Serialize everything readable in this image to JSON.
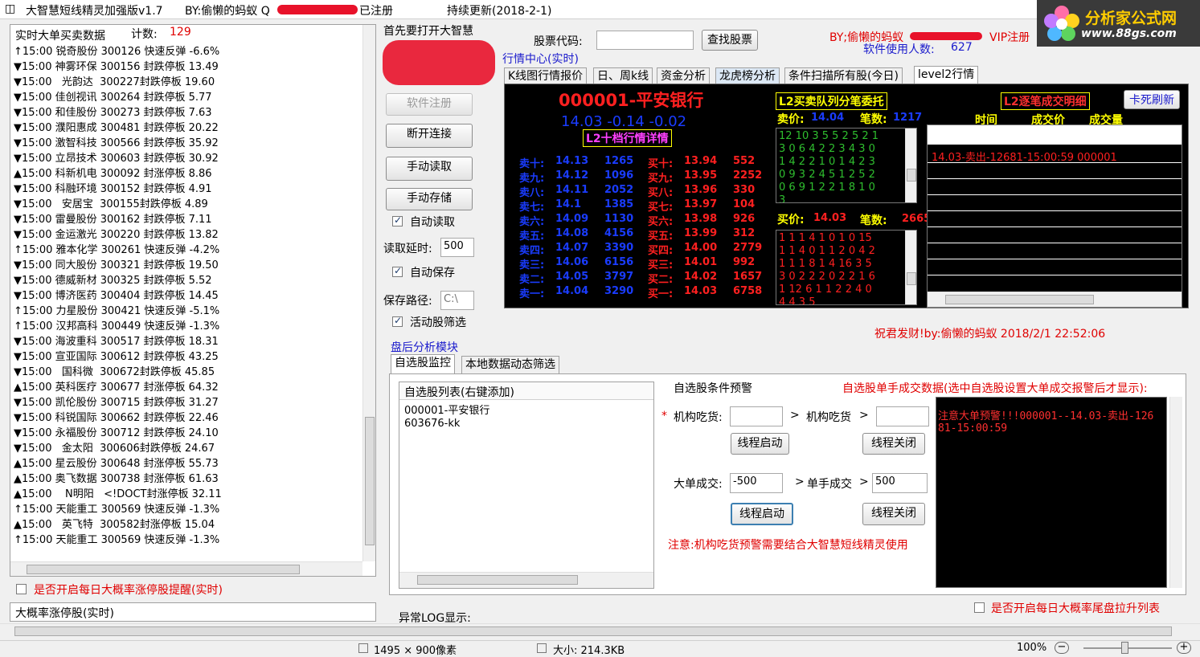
{
  "window": {
    "title": "大智慧短线精灵加强版v1.7",
    "author": "BY:偷懒的蚂蚁 Q",
    "registered": "已注册",
    "update": "持续更新(2018-2-1)"
  },
  "logo": {
    "main": "分析家公式网",
    "url": "www.88gs.com"
  },
  "realtime": {
    "title": "实时大单买卖数据",
    "count_label": "计数:",
    "count": "129",
    "rows": [
      "↑15:00 锐奇股份 300126 快速反弹 -6.6%",
      "▼15:00 神雾环保 300156 封跌停板 13.49",
      "▼15:00   光韵达  300227封跌停板 19.60",
      "▼15:00 佳创视讯 300264 封跌停板 5.77",
      "▼15:00 和佳股份 300273 封跌停板 7.63",
      "▼15:00 濮阳惠成 300481 封跌停板 20.22",
      "▼15:00 激智科技 300566 封跌停板 35.92",
      "▼15:00 立昂技术 300603 封跌停板 30.92",
      "▲15:00 科新机电 300092 封涨停板 8.86",
      "▼15:00 科融环境 300152 封跌停板 4.91",
      "▼15:00   安居宝  300155封跌停板 4.89",
      "▼15:00 雷曼股份 300162 封跌停板 7.11",
      "▼15:00 金运激光 300220 封跌停板 13.82",
      "↑15:00 雅本化学 300261 快速反弹 -4.2%",
      "▼15:00 同大股份 300321 封跌停板 19.50",
      "▼15:00 德威新材 300325 封跌停板 5.52",
      "▼15:00 博济医药 300404 封跌停板 14.45",
      "↑15:00 力星股份 300421 快速反弹 -5.1%",
      "↑15:00 汉邦高科 300449 快速反弹 -1.3%",
      "▼15:00 海波重科 300517 封跌停板 18.31",
      "▼15:00 宣亚国际 300612 封跌停板 43.25",
      "▼15:00   国科微  300672封跌停板 45.85",
      "▲15:00 英科医疗 300677 封涨停板 64.32",
      "▼15:00 凯伦股份 300715 封跌停板 31.27",
      "▼15:00 科锐国际 300662 封跌停板 22.46",
      "▼15:00 永福股份 300712 封跌停板 24.10",
      "▼15:00   金太阳  300606封跌停板 24.67",
      "▲15:00 星云股份 300648 封涨停板 55.73",
      "▲15:00 奥飞数据 300738 封涨停板 61.63",
      "▲15:00    N明阳   <!DOCT封涨停板 32.11",
      "↑15:00 天能重工 300569 快速反弹 -1.3%",
      "▲15:00   英飞特  300582封涨停板 15.04",
      "↑15:00 天能重工 300569 快速反弹 -1.3%"
    ],
    "remind_label": "是否开启每日大概率涨停股提醒(实时)",
    "bottom_title": "大概率涨停股(实时)"
  },
  "controls": {
    "first_open": "首先要打开大智慧",
    "register": "软件注册",
    "disconnect": "断开连接",
    "manual_read": "手动读取",
    "manual_save": "手动存储",
    "auto_read": "自动读取",
    "read_delay_label": "读取延时:",
    "read_delay": "500",
    "auto_save": "自动保存",
    "save_path_label": "保存路径:",
    "save_path": "C:\\",
    "active_filter": "活动股筛选"
  },
  "header": {
    "code_label": "股票代码:",
    "search": "查找股票",
    "author": "BY;偷懒的蚂蚁",
    "vip": "VIP注册",
    "users_label": "软件使用人数:",
    "users": "627",
    "market_center": "行情中心(实时)"
  },
  "tabs": [
    "K线图行情报价",
    "日、周k线",
    "资金分析",
    "龙虎榜分析",
    "条件扫描所有股(今日)",
    "level2行情"
  ],
  "l2": {
    "stock": "000001-平安银行",
    "price_line": "14.03 -0.14 -0.02",
    "ten_level": "L2十档行情详情",
    "sells": [
      [
        "卖十:",
        "14.13",
        "1265"
      ],
      [
        "卖九:",
        "14.12",
        "1096"
      ],
      [
        "卖八:",
        "14.11",
        "2052"
      ],
      [
        "卖七:",
        "14.1",
        "1385"
      ],
      [
        "卖六:",
        "14.09",
        "1130"
      ],
      [
        "卖五:",
        "14.08",
        "4156"
      ],
      [
        "卖四:",
        "14.07",
        "3390"
      ],
      [
        "卖三:",
        "14.06",
        "6156"
      ],
      [
        "卖二:",
        "14.05",
        "3797"
      ],
      [
        "卖一:",
        "14.04",
        "3290"
      ]
    ],
    "buys": [
      [
        "买十:",
        "13.94",
        "552"
      ],
      [
        "买九:",
        "13.95",
        "2252"
      ],
      [
        "买八:",
        "13.96",
        "330"
      ],
      [
        "买七:",
        "13.97",
        "104"
      ],
      [
        "买六:",
        "13.98",
        "926"
      ],
      [
        "买五:",
        "13.99",
        "312"
      ],
      [
        "买四:",
        "14.00",
        "2779"
      ],
      [
        "买三:",
        "14.01",
        "992"
      ],
      [
        "买二:",
        "14.02",
        "1657"
      ],
      [
        "买一:",
        "14.03",
        "6758"
      ]
    ],
    "queue_title": "L2买卖队列分笔委托",
    "sell_price_label": "卖价:",
    "sell_price": "14.04",
    "sell_count_label": "笔数:",
    "sell_count": "1217",
    "sell_queue": [
      "12 10 3 5 5 2 5 2 1",
      "3 0 6 4 2 2 3 4 3 0",
      "1 4 2 2 1 0 1 4 2 3",
      "0 9 3 2 4 5 1 2 5 2",
      "0 6 9 1 2 2 1 8 1 0",
      "3"
    ],
    "buy_price_label": "买价:",
    "buy_price": "14.03",
    "buy_count_label": "笔数:",
    "buy_count": "2665",
    "buy_queue": [
      "1 1 1 4 1 0 1 0 15",
      "1 1 4 0 1 1 2 0 4 2",
      "1 1 1 8 1 4 16 3 5",
      "3 0 2 2 2 0 2 2 1 6",
      "1 12 6 1 1 2 2 4 0",
      "4 4 3 5"
    ],
    "trade_title": "L2逐笔成交明细",
    "refresh": "卡死刷新",
    "col_time": "时间",
    "col_price": "成交价",
    "col_vol": "成交量",
    "trade_row": "14.03-卖出-12681-15:00:59 000001"
  },
  "greeting": "祝君发财!by:偷懒的蚂蚁 2018/2/1 22:52:06",
  "analysis": {
    "title": "盘后分析模块",
    "tab1": "自选股监控",
    "tab2": "本地数据动态筛选",
    "list_header": "自选股列表(右键添加)",
    "list_items": [
      "000001-平安银行",
      "603676-kk"
    ],
    "cond_title": "自选股条件预警",
    "inst_label": "机构吃货:",
    "inst_label2": "机构吃货",
    "start": "线程启动",
    "stop": "线程关闭",
    "big_label": "大单成交:",
    "big_value": "-500",
    "single_label": "单手成交",
    "single_value": "500",
    "note": "注意:机构吃货预警需要结合大智慧短线精灵使用",
    "trade_title": "自选股单手成交数据(选中自选股设置大单成交报警后才显示):",
    "alert": "注意大单预警!!!000001--14.03-卖出-12681-15:00:59",
    "tail_label": "是否开启每日大概率尾盘拉升列表",
    "log_label": "异常LOG显示:"
  },
  "statusbar": {
    "dims": "1495 × 900像素",
    "size": "大小: 214.3KB",
    "zoom": "100%"
  },
  "colors": {
    "sell": "#1a3cff",
    "buy": "#ff2020",
    "yellow": "#ffff00",
    "green_grid": "#2fbf2f"
  }
}
